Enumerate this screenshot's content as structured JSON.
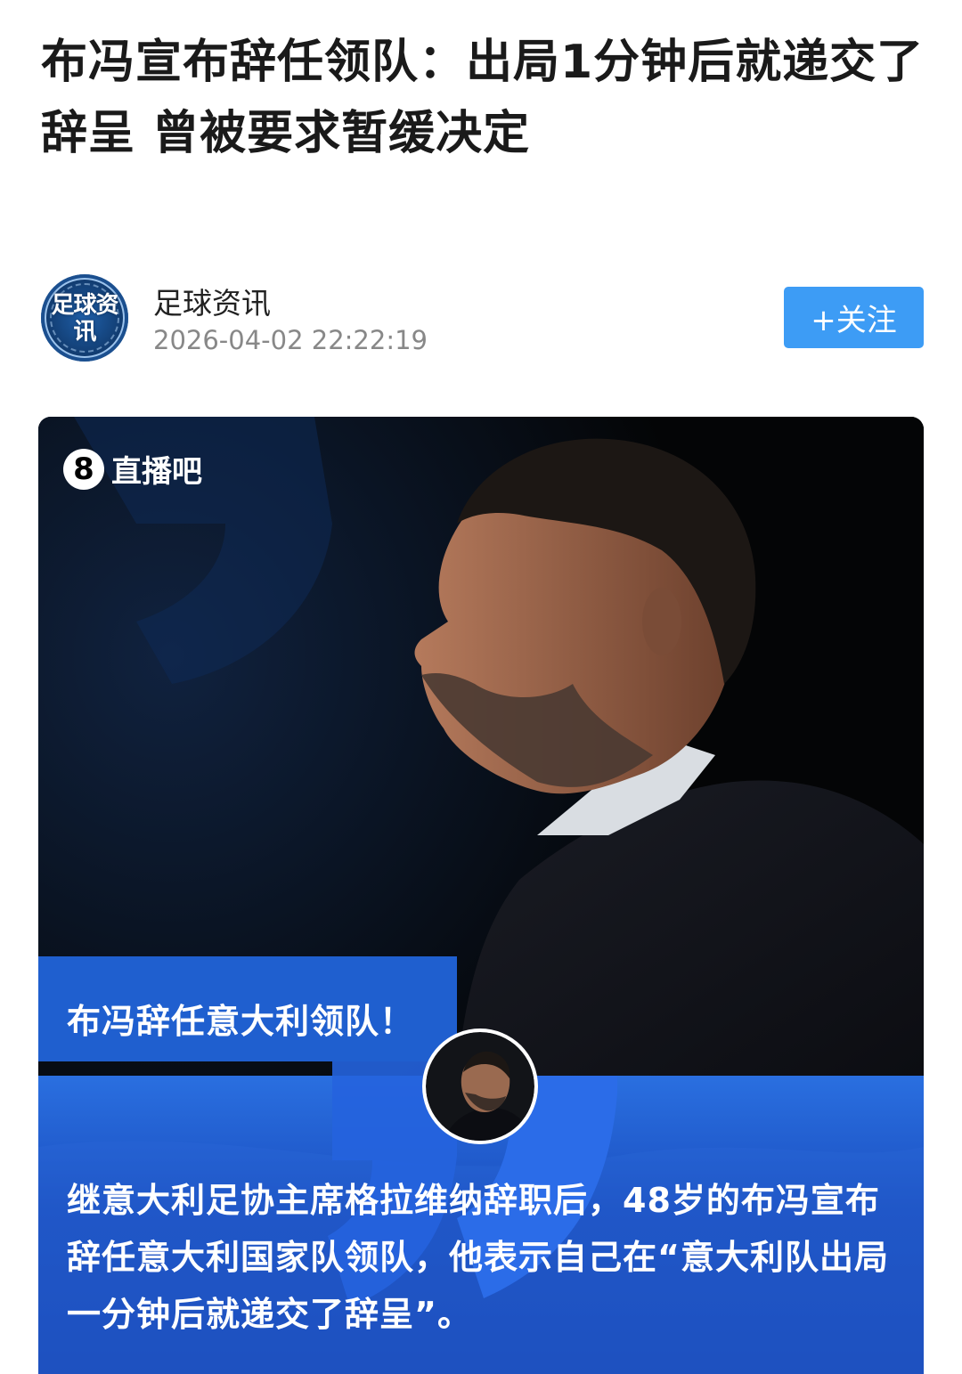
{
  "article": {
    "headline": "布冯宣布辞任领队：出局1分钟后就递交了辞呈 曾被要求暂缓决定"
  },
  "author": {
    "avatar_text": "足球资讯",
    "name": "足球资讯",
    "publish_time": "2026-04-02 22:22:19",
    "follow_label": "+关注"
  },
  "hero": {
    "brand_logo_mark": "8",
    "brand_logo_name": "直播吧",
    "banner_title": "布冯辞任意大利领队！",
    "summary": "继意大利足协主席格拉维纳辞职后，48岁的布冯宣布辞任意大利国家队领队，他表示自己在“意大利队出局一分钟后就递交了辞呈”。"
  },
  "colors": {
    "follow_button": "#3d9cf5",
    "banner_blue": "#1f5fcf",
    "text_primary": "#1a1a1a",
    "text_secondary": "#888888"
  }
}
